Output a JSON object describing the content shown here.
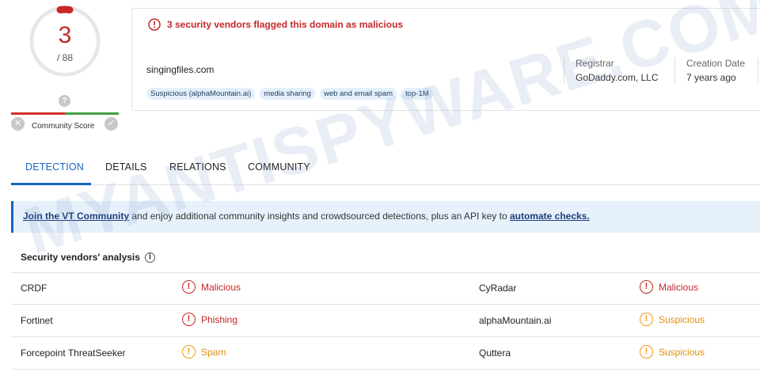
{
  "score": {
    "value": "3",
    "total": "/ 88"
  },
  "community": {
    "label": "Community Score",
    "question_mark": "?"
  },
  "alert": {
    "text": "3 security vendors flagged this domain as malicious"
  },
  "domain": {
    "name": "singingfiles.com"
  },
  "tags": [
    "Suspicious (alphaMountain.ai)",
    "media sharing",
    "web and email spam",
    "top-1M"
  ],
  "meta": {
    "registrar_label": "Registrar",
    "registrar_value": "GoDaddy.com, LLC",
    "creation_label": "Creation Date",
    "creation_value": "7 years ago"
  },
  "tabs": [
    "DETECTION",
    "DETAILS",
    "RELATIONS",
    "COMMUNITY"
  ],
  "banner": {
    "link1": "Join the VT Community",
    "text": " and enjoy additional community insights and crowdsourced detections, plus an API key to ",
    "link2": "automate checks."
  },
  "vendors": {
    "title": "Security vendors' analysis",
    "rows": [
      {
        "left_vendor": "CRDF",
        "left_result": "Malicious",
        "right_vendor": "CyRadar",
        "right_result": "Malicious"
      },
      {
        "left_vendor": "Fortinet",
        "left_result": "Phishing",
        "right_vendor": "alphaMountain.ai",
        "right_result": "Suspicious"
      },
      {
        "left_vendor": "Forcepoint ThreatSeeker",
        "left_result": "Spam",
        "right_vendor": "Quttera",
        "right_result": "Suspicious"
      }
    ]
  },
  "watermark": "MYANTISPYWARE.COM",
  "colors": {
    "malicious": "#c62828",
    "suspicious": "#f19a16",
    "accent": "#1565c0"
  },
  "icons": {
    "alert": "alert-circle-icon",
    "malicious": "exclamation-circle-icon",
    "suspicious": "warning-circle-icon",
    "info": "info-icon"
  }
}
